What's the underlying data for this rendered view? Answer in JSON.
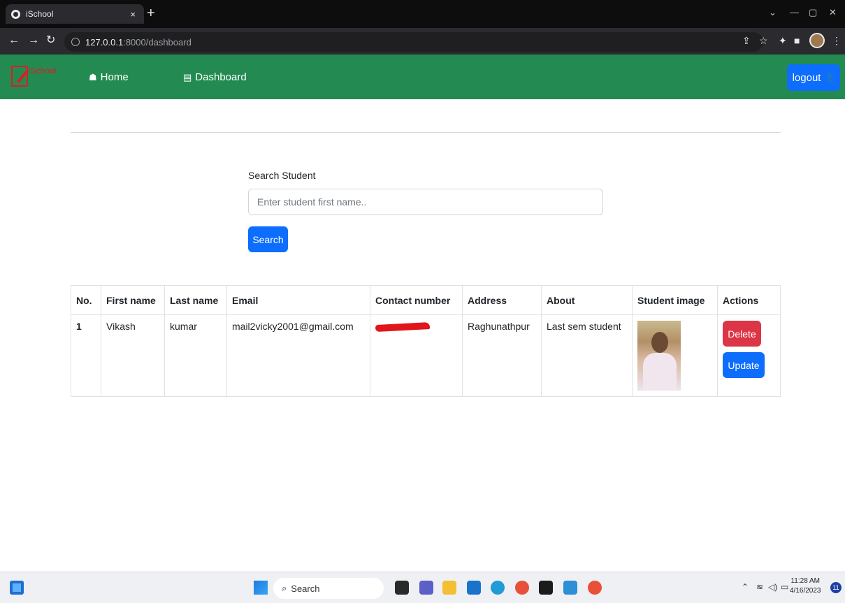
{
  "browser": {
    "tab_title": "iSchool",
    "tab_close": "×",
    "new_tab": "+",
    "url_host": "127.0.0.1",
    "url_rest": ":8000/dashboard"
  },
  "navbar": {
    "brand": "iSchool",
    "home_label": "Home",
    "dashboard_label": "Dashboard",
    "logout_label": "logout",
    "color": "#238b51"
  },
  "search": {
    "label": "Search Student",
    "placeholder": "Enter student first name..",
    "button_label": "Search"
  },
  "table": {
    "headers": [
      "No.",
      "First name",
      "Last name",
      "Email",
      "Contact number",
      "Address",
      "About",
      "Student image",
      "Actions"
    ],
    "rows": [
      {
        "no": "1",
        "first_name": "Vikash",
        "last_name": "kumar",
        "email": "mail2vicky2001@gmail.com",
        "contact": "[redacted]",
        "address": "Raghunathpur",
        "about": "Last sem student",
        "delete_label": "Delete",
        "update_label": "Update"
      }
    ]
  },
  "taskbar": {
    "search_label": "Search",
    "time": "11:28 AM",
    "date": "4/16/2023",
    "notification_count": "11"
  }
}
